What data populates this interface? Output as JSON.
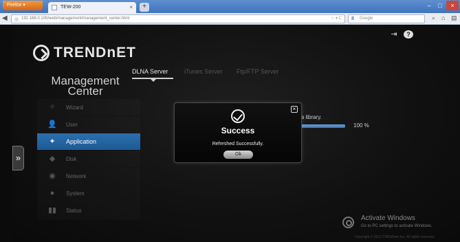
{
  "browser": {
    "menu_button": "Firefox ▾",
    "tab_title": "TEW-200",
    "tab_close": "×",
    "new_tab": "+",
    "url": "192.168.0.100/web/management/management_center.html",
    "search_engine": "Google",
    "controls": {
      "minimize": "–",
      "maximize": "□",
      "close": "×"
    }
  },
  "app": {
    "logo_text": "TRENDnET",
    "title": "Management Center",
    "side_toggle": "»",
    "top_icons": {
      "logout": "⇥",
      "help": "?"
    }
  },
  "sidebar": {
    "items": [
      {
        "label": "Wizard",
        "icon": "wizard-icon",
        "glyph": "✧"
      },
      {
        "label": "User",
        "icon": "user-icon",
        "glyph": "👤"
      },
      {
        "label": "Application",
        "icon": "application-icon",
        "glyph": "✦",
        "active": true
      },
      {
        "label": "Disk",
        "icon": "disk-icon",
        "glyph": "◆"
      },
      {
        "label": "Network",
        "icon": "network-icon",
        "glyph": "◉"
      },
      {
        "label": "System",
        "icon": "system-icon",
        "glyph": "●"
      },
      {
        "label": "Status",
        "icon": "status-icon",
        "glyph": "▮▮"
      }
    ]
  },
  "tabs": [
    "DLNA Server",
    "iTunes Server",
    "Ftp/FTP Server"
  ],
  "background": {
    "message": "ia library.",
    "progress": 1.0,
    "progress_label": "100 %"
  },
  "modal": {
    "title": "Success",
    "message": "Refreshed Successfully.",
    "ok_label": "Ok",
    "close": "×"
  },
  "watermark": {
    "title": "Activate Windows",
    "subtitle": "Go to PC settings to activate Windows.",
    "copyright": "Copyright © 2013 TRENDnet Inc. All rights reserved."
  },
  "colors": {
    "accent": "#1f5f9c",
    "progress": "#4f86c6"
  }
}
